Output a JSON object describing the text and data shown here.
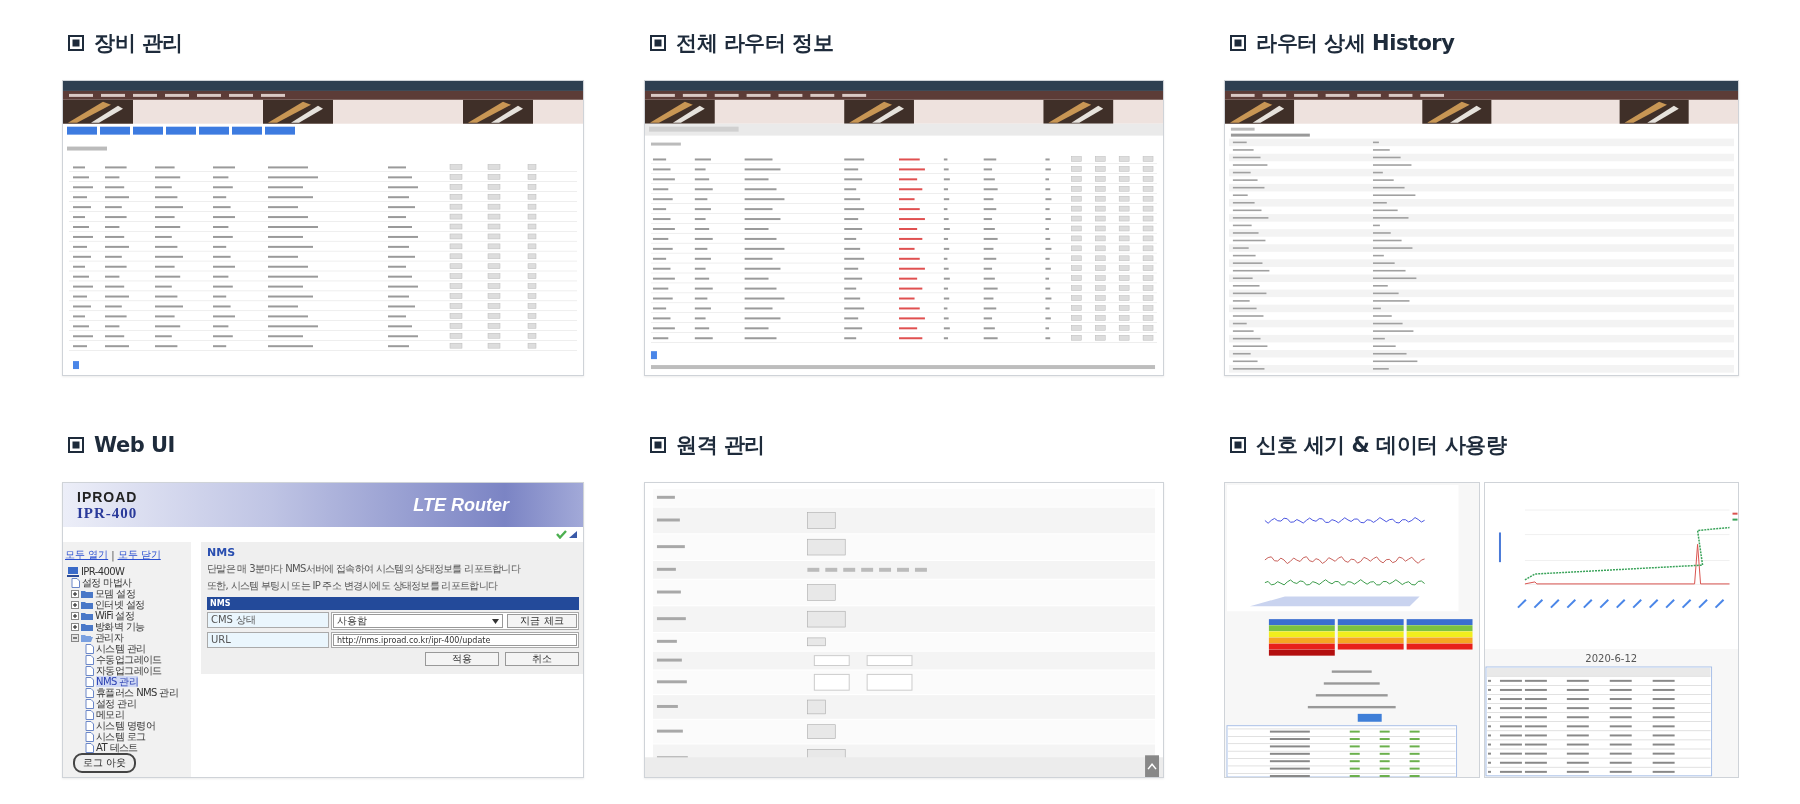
{
  "sections": [
    {
      "title": "장비 관리",
      "kind": "device_table"
    },
    {
      "title": "전체 라우터 정보",
      "kind": "router_table"
    },
    {
      "title": "라우터 상세 History",
      "kind": "router_detail"
    },
    {
      "title": "Web UI",
      "kind": "web_ui",
      "web_ui": {
        "logo": "IPROAD",
        "model": "IPR-400",
        "banner": "LTE Router",
        "links": [
          "모두 열기",
          "모두 닫기"
        ],
        "separator": "|",
        "tree": {
          "label": "IPR-400W",
          "children": [
            {
              "label": "설정 마법사",
              "kind": "page",
              "selected": false
            },
            {
              "label": "모뎀 설정",
              "kind": "folder",
              "expanded": false
            },
            {
              "label": "인터넷 설정",
              "kind": "folder",
              "expanded": false
            },
            {
              "label": "WiFi 설정",
              "kind": "folder",
              "expanded": false
            },
            {
              "label": "방화벽 기능",
              "kind": "folder",
              "expanded": false
            },
            {
              "label": "관리자",
              "kind": "folder",
              "expanded": true,
              "children": [
                {
                  "label": "시스템 관리",
                  "kind": "page",
                  "selected": false
                },
                {
                  "label": "수동업그레이드",
                  "kind": "page",
                  "selected": false
                },
                {
                  "label": "자동업그레이드",
                  "kind": "page",
                  "selected": false
                },
                {
                  "label": "NMS 관리",
                  "kind": "page",
                  "selected": true
                },
                {
                  "label": "휴플러스 NMS 관리",
                  "kind": "page",
                  "selected": false
                },
                {
                  "label": "설정 관리",
                  "kind": "page",
                  "selected": false
                },
                {
                  "label": "메모리",
                  "kind": "page",
                  "selected": false
                },
                {
                  "label": "시스템 명령어",
                  "kind": "page",
                  "selected": false
                },
                {
                  "label": "시스템 로그",
                  "kind": "page",
                  "selected": false
                },
                {
                  "label": "AT 테스트",
                  "kind": "page",
                  "selected": false
                }
              ]
            }
          ]
        },
        "logout": "로그 아웃",
        "panel": {
          "title": "NMS",
          "description": [
            "단말은 매 3분마다 NMS서버에 접속하여 시스템의 상태정보를 리포트합니다",
            "또한, 시스템 부팅시 또는 IP 주소 변경시에도 상태정보를 리포트합니다"
          ],
          "table_title": "NMS",
          "rows": [
            {
              "label": "CMS 상태",
              "kind": "select",
              "value": "사용함",
              "button": "지금 체크"
            },
            {
              "label": "URL",
              "kind": "input",
              "value": "http://nms.iproad.co.kr/ipr-400/update"
            }
          ],
          "buttons": [
            "적용",
            "취소"
          ]
        }
      }
    },
    {
      "title": "원격 관리",
      "kind": "remote"
    },
    {
      "title": "신호 세기 & 데이터 사용량",
      "kind": "signal",
      "date": "2020-6-12"
    }
  ]
}
